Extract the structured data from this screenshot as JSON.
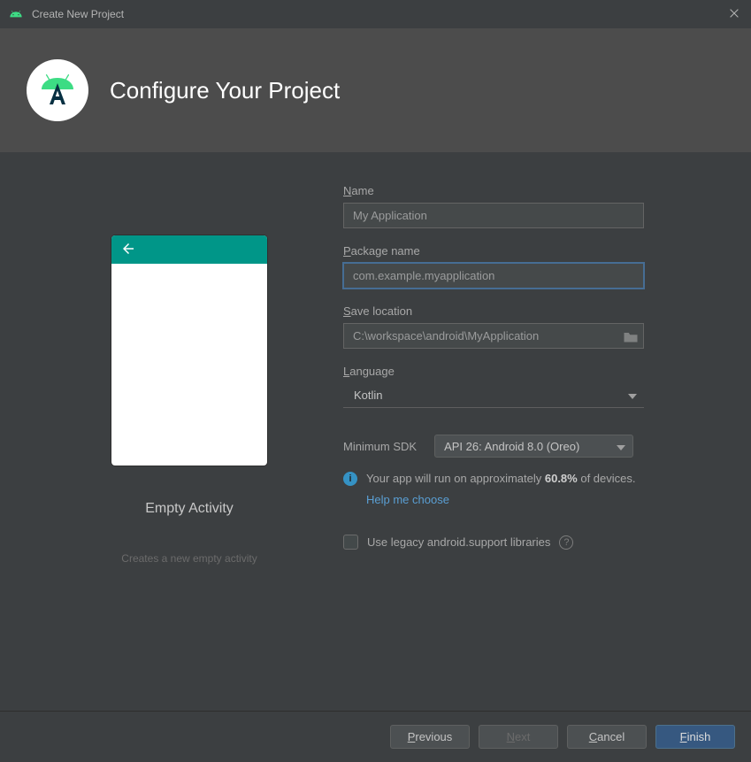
{
  "window": {
    "title": "Create New Project"
  },
  "header": {
    "title": "Configure Your Project"
  },
  "preview": {
    "template_name": "Empty Activity",
    "template_desc": "Creates a new empty activity"
  },
  "form": {
    "name": {
      "label_pre": "N",
      "label_rest": "ame",
      "value": "My Application"
    },
    "package": {
      "label_pre": "P",
      "label_rest": "ackage name",
      "value": "com.example.myapplication"
    },
    "save": {
      "label_pre": "S",
      "label_rest": "ave location",
      "value": "C:\\workspace\\android\\MyApplication"
    },
    "language": {
      "label_pre": "L",
      "label_rest": "anguage",
      "value": "Kotlin"
    },
    "sdk": {
      "label": "Minimum SDK",
      "value": "API 26: Android 8.0 (Oreo)"
    },
    "info": {
      "pre": "Your app will run on approximately ",
      "pct": "60.8%",
      "post": " of devices.",
      "link": "Help me choose"
    },
    "legacy": {
      "label": "Use legacy android.support libraries"
    }
  },
  "buttons": {
    "previous_pre": "P",
    "previous_rest": "revious",
    "next_pre": "N",
    "next_rest": "ext",
    "cancel_pre": "C",
    "cancel_rest": "ancel",
    "finish_pre": "F",
    "finish_rest": "inish"
  }
}
